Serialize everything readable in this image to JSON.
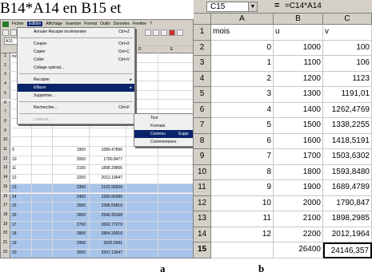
{
  "top_text": "B14*A14  en  B15  et",
  "panel_a": {
    "menubar": [
      "Fichier",
      "Edition",
      "Affichage",
      "Insertion",
      "Format",
      "Outils",
      "Données",
      "Fenêtre",
      "?"
    ],
    "font_name": "Arial",
    "name_box": "A15",
    "col_headers": [
      "D",
      "E"
    ],
    "rows": [
      {
        "n": "1",
        "a": "mois",
        "b": "",
        "c": ""
      },
      {
        "n": "2",
        "a": "",
        "b": "",
        "c": ""
      },
      {
        "n": "3",
        "a": "",
        "b": "",
        "c": ""
      },
      {
        "n": "4",
        "a": "",
        "b": "",
        "c": ""
      },
      {
        "n": "5",
        "a": "",
        "b": "",
        "c": ""
      },
      {
        "n": "6",
        "a": "",
        "b": "",
        "c": ""
      },
      {
        "n": "7",
        "a": "",
        "b": "",
        "c": ""
      },
      {
        "n": "8",
        "a": "",
        "b": "",
        "c": ""
      },
      {
        "n": "9",
        "a": "",
        "b": "",
        "c": ""
      },
      {
        "n": "10",
        "a": "",
        "b": "",
        "c": ""
      },
      {
        "n": "11",
        "a": "9",
        "b": "1900",
        "c": "1689.47896"
      },
      {
        "n": "12",
        "a": "10",
        "b": "2000",
        "c": "1790.8477"
      },
      {
        "n": "13",
        "a": "11",
        "b": "2100",
        "c": "1898.29856"
      },
      {
        "n": "14",
        "a": "12",
        "b": "2200",
        "c": "2012.19647"
      },
      {
        "n": "15",
        "a": "13",
        "b": "2300",
        "c": "2132.92826"
      },
      {
        "n": "16",
        "a": "14",
        "b": "2400",
        "c": "2260.90396"
      },
      {
        "n": "17",
        "a": "15",
        "b": "2500",
        "c": "2396.55819"
      },
      {
        "n": "18",
        "a": "16",
        "b": "2600",
        "c": "2540.35168"
      },
      {
        "n": "19",
        "a": "17",
        "b": "2700",
        "c": "2692.77279"
      },
      {
        "n": "20",
        "a": "18",
        "b": "2800",
        "c": "2854.33916"
      },
      {
        "n": "21",
        "a": "19",
        "b": "2900",
        "c": "3025.5991"
      },
      {
        "n": "22",
        "a": "20",
        "b": "3000",
        "c": "3207.13547"
      }
    ],
    "edit_menu": [
      {
        "label": "Annuler Recopie incrémentée",
        "shortcut": "Ctrl+Z"
      },
      {
        "sep": true
      },
      {
        "label": "Couper",
        "shortcut": "Ctrl+X"
      },
      {
        "label": "Copier",
        "shortcut": "Ctrl+C"
      },
      {
        "label": "Coller",
        "shortcut": "Ctrl+V"
      },
      {
        "label": "Collage spécial...",
        "shortcut": ""
      },
      {
        "sep": true
      },
      {
        "label": "Recopier",
        "shortcut": ""
      },
      {
        "label": "Effacer",
        "shortcut": ""
      },
      {
        "label": "Supprimer...",
        "shortcut": ""
      },
      {
        "sep": true
      },
      {
        "label": "Rechercher...",
        "shortcut": "Ctrl+F"
      },
      {
        "sep": true
      },
      {
        "label": "Liaisons...",
        "shortcut": ""
      }
    ],
    "submenu": [
      {
        "label": "Tout",
        "shortcut": ""
      },
      {
        "label": "Formats",
        "shortcut": ""
      },
      {
        "label": "Contenu",
        "shortcut": "Suppr"
      },
      {
        "label": "Commentaires",
        "shortcut": ""
      }
    ],
    "caption": "a"
  },
  "panel_b": {
    "name_box": "C15",
    "equals": "=",
    "formula": "=C14*A14",
    "col_headers": [
      "A",
      "B",
      "C"
    ],
    "rows": [
      {
        "n": "1",
        "a": "mois",
        "b": "u",
        "c": "v"
      },
      {
        "n": "2",
        "a": "0",
        "b": "1000",
        "c": "100"
      },
      {
        "n": "3",
        "a": "1",
        "b": "1100",
        "c": "106"
      },
      {
        "n": "4",
        "a": "2",
        "b": "1200",
        "c": "1123"
      },
      {
        "n": "5",
        "a": "3",
        "b": "1300",
        "c": "1191,01"
      },
      {
        "n": "6",
        "a": "4",
        "b": "1400",
        "c": "1262,4769"
      },
      {
        "n": "7",
        "a": "5",
        "b": "1500",
        "c": "1338,2255"
      },
      {
        "n": "8",
        "a": "6",
        "b": "1600",
        "c": "1418,5191"
      },
      {
        "n": "9",
        "a": "7",
        "b": "1700",
        "c": "1503,6302"
      },
      {
        "n": "10",
        "a": "8",
        "b": "1800",
        "c": "1593,8480"
      },
      {
        "n": "11",
        "a": "9",
        "b": "1900",
        "c": "1689,4789"
      },
      {
        "n": "12",
        "a": "10",
        "b": "2000",
        "c": "1790,847"
      },
      {
        "n": "13",
        "a": "11",
        "b": "2100",
        "c": "1898,2985"
      },
      {
        "n": "14",
        "a": "12",
        "b": "2200",
        "c": "2012,1964"
      },
      {
        "n": "15",
        "a": "",
        "b": "26400",
        "c": "24146,357"
      }
    ],
    "caption": "b"
  }
}
